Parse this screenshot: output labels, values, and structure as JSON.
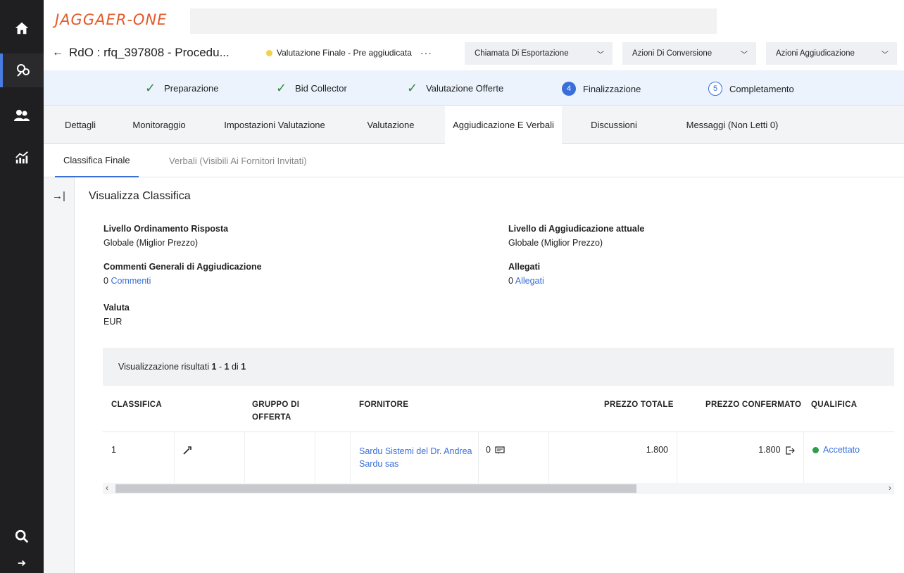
{
  "brand": {
    "logo": "JAGGAER-ONE"
  },
  "sidebar": {
    "items": [
      {
        "icon": "home-icon"
      },
      {
        "icon": "sourcing-icon",
        "active": true
      },
      {
        "icon": "users-icon"
      },
      {
        "icon": "analytics-icon"
      },
      {
        "icon": "search-icon"
      },
      {
        "icon": "expand-arrow-icon"
      }
    ]
  },
  "header": {
    "back_title": "RdO : rfq_397808 - Procedu...",
    "status": "Valutazione Finale - Pre aggiudicata",
    "more": "···",
    "dropdowns": [
      "Chiamata Di Esportazione",
      "Azioni Di Conversione",
      "Azioni Aggiudicazione"
    ]
  },
  "stepper": {
    "steps": [
      {
        "label": "Preparazione",
        "state": "done"
      },
      {
        "label": "Bid Collector",
        "state": "done"
      },
      {
        "label": "Valutazione Offerte",
        "state": "done"
      },
      {
        "label": "Finalizzazione",
        "state": "current",
        "number": "4"
      },
      {
        "label": "Completamento",
        "state": "upcoming",
        "number": "5"
      }
    ]
  },
  "tabs": [
    "Dettagli",
    "Monitoraggio",
    "Impostazioni Valutazione",
    "Valutazione",
    "Aggiudicazione E Verbali",
    "Discussioni",
    "Messaggi (Non Letti 0)"
  ],
  "subtabs": [
    "Classifica Finale",
    "Verbali (Visibili Ai Fornitori Invitati)"
  ],
  "section": {
    "title": "Visualizza Classifica",
    "fields": {
      "ordering_level": {
        "label": "Livello Ordinamento Risposta",
        "value": "Globale (Miglior Prezzo)"
      },
      "award_level": {
        "label": "Livello di Aggiudicazione attuale",
        "value": "Globale (Miglior Prezzo)"
      },
      "comments": {
        "label": "Commenti Generali di Aggiudicazione",
        "count": "0",
        "link": "Commenti"
      },
      "attachments": {
        "label": "Allegati",
        "count": "0",
        "link": "Allegati"
      },
      "currency": {
        "label": "Valuta",
        "value": "EUR"
      }
    }
  },
  "table": {
    "info_prefix": "Visualizzazione risultati",
    "range_from": "1",
    "range_sep": " - ",
    "range_to": "1",
    "of_label": " di ",
    "total": "1",
    "columns": {
      "rank": "CLASSIFICA",
      "group": "GRUPPO DI OFFERTA",
      "supplier": "FORNITORE",
      "total_price": "PREZZO TOTALE",
      "confirmed_price": "PREZZO CONFERMATO",
      "qualification": "QUALIFICA"
    },
    "rows": [
      {
        "rank": "1",
        "supplier": "Sardu Sistemi del Dr. Andrea Sardu sas",
        "messages": "0",
        "total_price": "1.800",
        "confirmed_price": "1.800",
        "qualification": "Accettato"
      }
    ]
  },
  "colors": {
    "accent": "#3a6fd8",
    "sidebar": "#1f1f21",
    "logo": "#e25a2a",
    "success": "#2e9d4d",
    "status_dot": "#f5d04a"
  }
}
